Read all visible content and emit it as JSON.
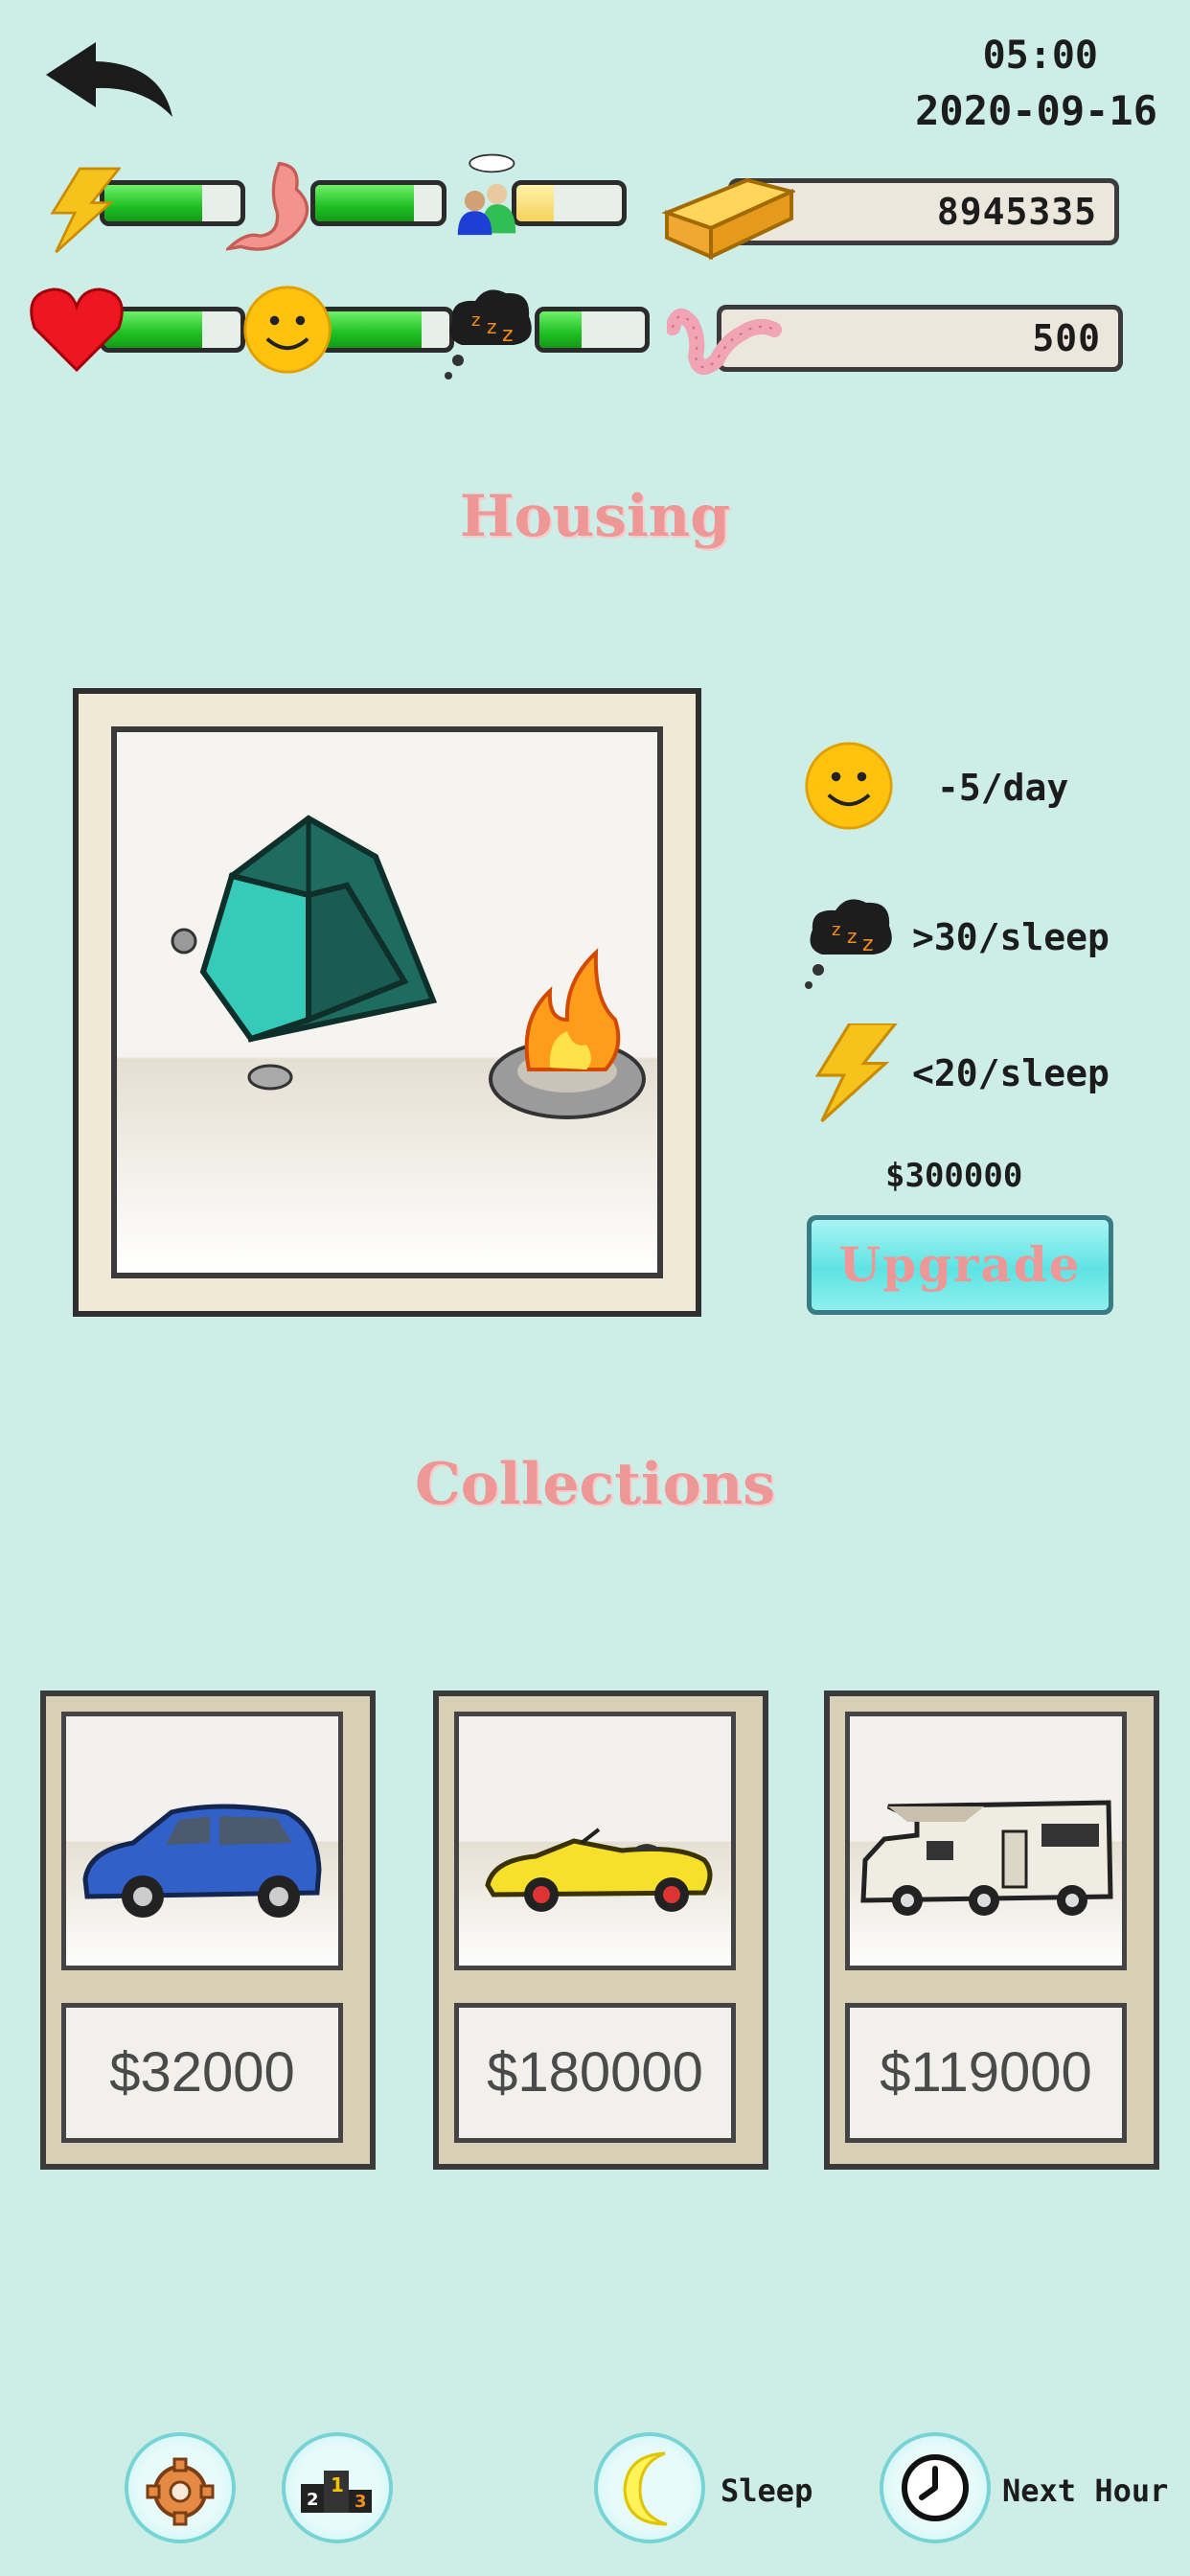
{
  "header": {
    "time": "05:00",
    "date": "2020-09-16",
    "back_icon": "back-arrow-icon"
  },
  "stats": {
    "energy": {
      "icon": "lightning-icon",
      "level": 0.72
    },
    "hunger": {
      "icon": "stomach-icon",
      "level": 0.78
    },
    "social": {
      "icon": "people-chat-icon",
      "level": 0.35
    },
    "health": {
      "icon": "heart-icon",
      "level": 0.72
    },
    "happiness": {
      "icon": "smiley-icon",
      "level": 0.78
    },
    "sleep": {
      "icon": "sleep-cloud-icon",
      "level": 0.4
    }
  },
  "resources": {
    "gold": {
      "icon": "gold-bar-icon",
      "value": "8945335"
    },
    "worms": {
      "icon": "worm-icon",
      "value": "500"
    }
  },
  "housing": {
    "title": "Housing",
    "image": "tent-campfire",
    "effects": [
      {
        "icon": "smiley-icon",
        "text": "-5/day"
      },
      {
        "icon": "sleep-cloud-icon",
        "text": ">30/sleep"
      },
      {
        "icon": "lightning-icon",
        "text": "<20/sleep"
      }
    ],
    "upgrade_price": "$300000",
    "upgrade_label": "Upgrade"
  },
  "collections": {
    "title": "Collections",
    "items": [
      {
        "image": "blue-hatchback-car",
        "price": "$32000"
      },
      {
        "image": "yellow-sports-convertible",
        "price": "$180000"
      },
      {
        "image": "camper-rv",
        "price": "$119000"
      }
    ]
  },
  "bottom_bar": {
    "settings_icon": "gear-icon",
    "ranking_icon": "podium-icon",
    "sleep_label": "Sleep",
    "next_hour_label": "Next Hour"
  },
  "colors": {
    "background": "#cdeee6",
    "title_pink": "#ee9797",
    "bar_green": "#1fbf22",
    "upgrade_cyan": "#5ee3e3"
  }
}
